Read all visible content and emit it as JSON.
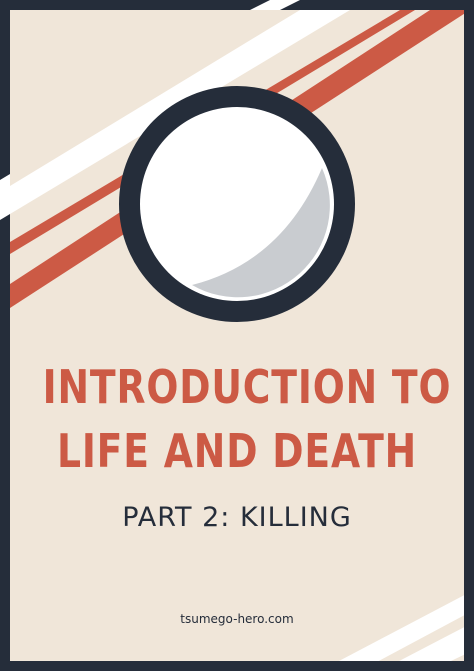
{
  "cover": {
    "title_line_1": "INTRODUCTION TO",
    "title_line_2": "LIFE AND DEATH",
    "subtitle": "PART 2: KILLING",
    "website": "tsumego-hero.com"
  },
  "colors": {
    "frame": "#252d3a",
    "background": "#f0e6d9",
    "accent": "#cc5a45",
    "stripe_light": "#ffffff",
    "stone_shade": "#c9ccd0"
  },
  "icons": {
    "emblem": "go-stone-ring-icon"
  }
}
